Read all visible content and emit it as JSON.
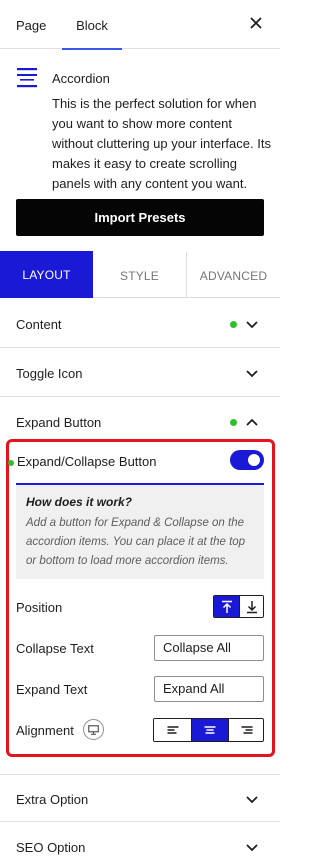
{
  "top_tabs": {
    "page": "Page",
    "block": "Block"
  },
  "block": {
    "title": "Accordion",
    "description": "This is the perfect solution for when you want to show more content without cluttering up your interface. Its makes it easy to create scrolling panels with any content you want.",
    "import_button": "Import Presets",
    "icon": "accordion-icon"
  },
  "layout_tabs": {
    "layout": "LAYOUT",
    "style": "STYLE",
    "advanced": "ADVANCED"
  },
  "panels": {
    "content": "Content",
    "toggle_icon": "Toggle Icon",
    "expand_button": "Expand Button",
    "extra_option": "Extra Option",
    "seo_option": "SEO Option"
  },
  "expand": {
    "toggle_label": "Expand/Collapse Button",
    "toggle_on": true,
    "info_title": "How does it work?",
    "info_text": "Add a button for Expand & Collapse on the accordion items. You can place it at the top or bottom to load more accordion items.",
    "position_label": "Position",
    "position_selected": "top",
    "collapse_text_label": "Collapse Text",
    "collapse_text_value": "Collapse All",
    "expand_text_label": "Expand Text",
    "expand_text_value": "Expand All",
    "alignment_label": "Alignment",
    "alignment_selected": "center"
  },
  "colors": {
    "accent": "#1a1ad6",
    "highlight_border": "#e5131d",
    "status_dot": "#2cc02c",
    "tab_underline": "#3858e9"
  }
}
